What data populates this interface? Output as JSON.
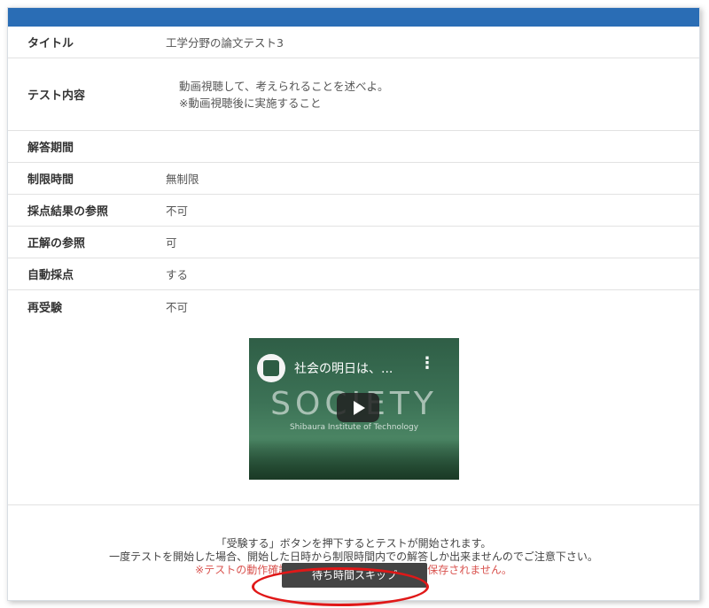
{
  "details": [
    {
      "label": "タイトル",
      "value": "工学分野の論文テスト3"
    },
    {
      "label": "テスト内容",
      "lines": [
        "動画視聴して、考えられることを述べよ。",
        "※動画視聴後に実施すること"
      ]
    },
    {
      "label": "解答期間",
      "value": ""
    },
    {
      "label": "制限時間",
      "value": "無制限"
    },
    {
      "label": "採点結果の参照",
      "value": "不可"
    },
    {
      "label": "正解の参照",
      "value": "可"
    },
    {
      "label": "自動採点",
      "value": "する"
    },
    {
      "label": "再受験",
      "value": "不可"
    }
  ],
  "video": {
    "title": "社会の明日は、...",
    "overlay_text": "SOCIETY",
    "overlay_subtext": "Shibaura Institute of Technology"
  },
  "notice": {
    "line1": "「受験する」ボタンを押下するとテストが開始されます。",
    "line2": "一度テストを開始した場合、開始した日時から制限時間内での解答しか出来ませんのでご注意下さい。",
    "warning": "※テストの動作確認用画面の為、解答した内容は保存されません。"
  },
  "buttons": {
    "skip_label": "待ち時間スキップ"
  },
  "colors": {
    "header_bar": "#2a6db5",
    "warning_text": "#d9534f",
    "button_bg": "#444444",
    "highlight_ring": "#e01818"
  }
}
